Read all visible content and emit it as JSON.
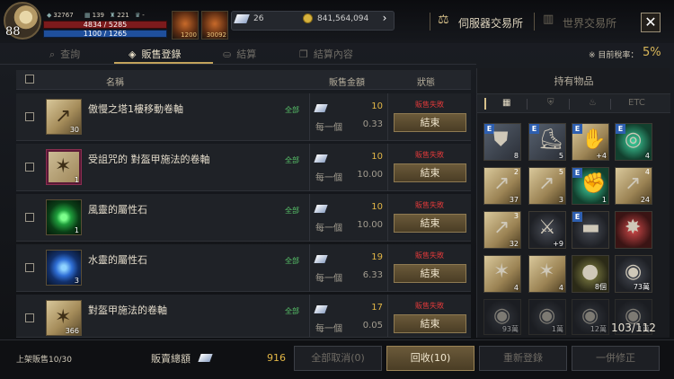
{
  "player": {
    "level": "88",
    "stat1": "32767",
    "stat2": "139",
    "stat3": "221",
    "stat4": "-",
    "hp": "4834 / 5285",
    "mp": "1100 / 1265"
  },
  "potions": {
    "potion1": "1200",
    "potion2": "30092"
  },
  "currency": {
    "crystal": "26",
    "gold": "841,564,094"
  },
  "header": {
    "tab_server": "伺服器交易所",
    "tab_world": "世界交易所",
    "close": "✕"
  },
  "tabs": [
    {
      "label": "查詢"
    },
    {
      "label": "販售登錄"
    },
    {
      "label": "結算"
    },
    {
      "label": "結算內容"
    }
  ],
  "tax": {
    "label": "※ 目前稅率：",
    "value": "5%"
  },
  "table": {
    "headers": {
      "name": "名稱",
      "price": "販售金額",
      "status": "狀態"
    },
    "rows": [
      {
        "name": "傲慢之塔1樓移動卷軸",
        "qty": "30",
        "scope": "全部",
        "price": "10",
        "per": "每一個",
        "unit": "0.33",
        "status": "販售失敗",
        "action": "結束"
      },
      {
        "name": "受詛咒的 對盔甲施法的卷軸",
        "qty": "1",
        "scope": "全部",
        "price": "10",
        "per": "每一個",
        "unit": "10.00",
        "status": "販售失敗",
        "action": "結束"
      },
      {
        "name": "風靈的屬性石",
        "qty": "1",
        "scope": "全部",
        "price": "10",
        "per": "每一個",
        "unit": "10.00",
        "status": "販售失敗",
        "action": "結束"
      },
      {
        "name": "水靈的屬性石",
        "qty": "3",
        "scope": "全部",
        "price": "19",
        "per": "每一個",
        "unit": "6.33",
        "status": "販售失敗",
        "action": "結束"
      },
      {
        "name": "對盔甲施法的卷軸",
        "qty": "366",
        "scope": "全部",
        "price": "17",
        "per": "每一個",
        "unit": "0.05",
        "status": "販售失敗",
        "action": "結束"
      }
    ]
  },
  "inventory": {
    "title": "持有物品",
    "filter_etc": "ETC",
    "capacity": "103/112",
    "slots": [
      {
        "q": "8",
        "badge": "E",
        "num": ""
      },
      {
        "q": "5",
        "badge": "E",
        "num": ""
      },
      {
        "q": "+4",
        "badge": "E",
        "num": ""
      },
      {
        "q": "4",
        "badge": "E",
        "num": ""
      },
      {
        "q": "37",
        "badge": "",
        "num": "2"
      },
      {
        "q": "3",
        "badge": "",
        "num": "5"
      },
      {
        "q": "1",
        "badge": "E",
        "num": ""
      },
      {
        "q": "24",
        "badge": "",
        "num": "4"
      },
      {
        "q": "32",
        "badge": "",
        "num": "3"
      },
      {
        "q": "+9",
        "badge": "",
        "num": ""
      },
      {
        "q": "",
        "badge": "E",
        "num": ""
      },
      {
        "q": "",
        "badge": "",
        "num": ""
      },
      {
        "q": "4",
        "badge": "",
        "num": ""
      },
      {
        "q": "4",
        "badge": "",
        "num": ""
      },
      {
        "q": "8個",
        "badge": "",
        "num": ""
      },
      {
        "q": "73萬",
        "badge": "",
        "num": ""
      },
      {
        "q": "93萬",
        "badge": "",
        "num": ""
      },
      {
        "q": "1萬",
        "badge": "",
        "num": ""
      },
      {
        "q": "12萬",
        "badge": "",
        "num": ""
      },
      {
        "q": "1萬",
        "badge": "",
        "num": ""
      }
    ]
  },
  "footer": {
    "limit": "上架販售10/30",
    "total_label": "販賣總額",
    "total_value": "916",
    "btn_cancel_all": "全部取消(0)",
    "btn_recall": "回收(10)",
    "btn_reregister": "重新登錄",
    "btn_modify": "一併修正"
  }
}
